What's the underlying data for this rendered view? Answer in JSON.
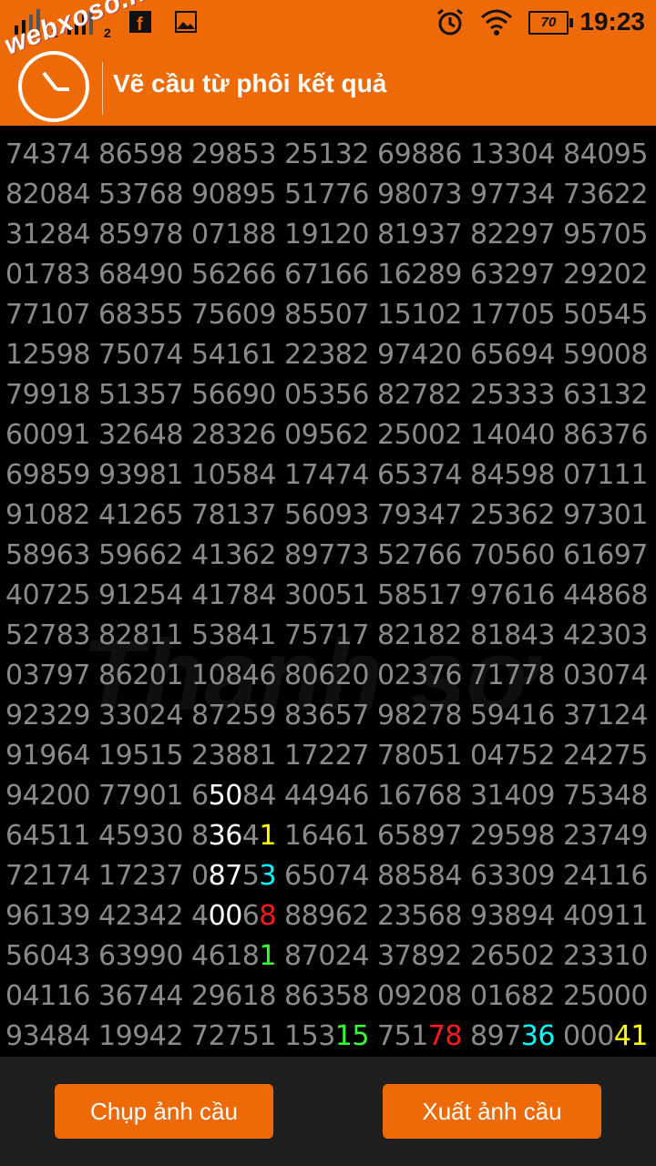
{
  "statusbar": {
    "sim1": "1",
    "sim2": "2",
    "battery": "70",
    "time": "19:23"
  },
  "appbar": {
    "logo": "webxoso.net",
    "title": "Vẽ cầu từ phôi kết quả"
  },
  "watermark": "Thanh sơ",
  "colors": {
    "accent": "#ee6a06",
    "digit_default": "#8a8a8a",
    "white": "#ffffff",
    "yellow": "#ffff00",
    "cyan": "#00ffff",
    "red": "#ff1a1a",
    "green": "#33ff33"
  },
  "rows": [
    [
      "74374",
      "86598",
      "29853",
      "25132",
      "69886",
      "13304",
      "84095"
    ],
    [
      "82084",
      "53768",
      "90895",
      "51776",
      "98073",
      "97734",
      "73622"
    ],
    [
      "31284",
      "85978",
      "07188",
      "19120",
      "81937",
      "82297",
      "95705"
    ],
    [
      "01783",
      "68490",
      "56266",
      "67166",
      "16289",
      "63297",
      "29202"
    ],
    [
      "77107",
      "68355",
      "75609",
      "85507",
      "15102",
      "17705",
      "50545"
    ],
    [
      "12598",
      "75074",
      "54161",
      "22382",
      "97420",
      "65694",
      "59008"
    ],
    [
      "79918",
      "51357",
      "56690",
      "05356",
      "82782",
      "25333",
      "63132"
    ],
    [
      "60091",
      "32648",
      "28326",
      "09562",
      "25002",
      "14040",
      "86376"
    ],
    [
      "69859",
      "93981",
      "10584",
      "17474",
      "65374",
      "84598",
      "07111"
    ],
    [
      "91082",
      "41265",
      "78137",
      "56093",
      "79347",
      "25362",
      "97301"
    ],
    [
      "58963",
      "59662",
      "41362",
      "89773",
      "52766",
      "70560",
      "61697"
    ],
    [
      "40725",
      "91254",
      "41784",
      "30051",
      "58517",
      "97616",
      "44868"
    ],
    [
      "52783",
      "82811",
      "53841",
      "75717",
      "82182",
      "81843",
      "42303"
    ],
    [
      "03797",
      "86201",
      "10846",
      "80620",
      "02376",
      "71778",
      "03074"
    ],
    [
      "92329",
      "33024",
      "87259",
      "83657",
      "98278",
      "59416",
      "37124"
    ],
    [
      "91964",
      "19515",
      "23881",
      "17227",
      "78051",
      "04752",
      "24275"
    ],
    [
      "94200",
      "77901",
      "65084",
      "44946",
      "16768",
      "31409",
      "75348"
    ],
    [
      "64511",
      "45930",
      "83641",
      "16461",
      "65897",
      "29598",
      "23749"
    ],
    [
      "72174",
      "17237",
      "08753",
      "65074",
      "88584",
      "63309",
      "24116"
    ],
    [
      "96139",
      "42342",
      "40068",
      "88962",
      "23568",
      "93894",
      "40911"
    ],
    [
      "56043",
      "63990",
      "46181",
      "87024",
      "37892",
      "26502",
      "23310"
    ],
    [
      "04116",
      "36744",
      "29618",
      "86358",
      "09208",
      "01682",
      "25000"
    ],
    [
      "93484",
      "19942",
      "72751",
      "15315",
      "75178",
      "89736",
      "00041"
    ]
  ],
  "highlights": [
    {
      "row": 16,
      "col": 2,
      "digits": [
        1,
        2
      ],
      "color": "white"
    },
    {
      "row": 17,
      "col": 2,
      "digits": [
        1,
        2
      ],
      "color": "white"
    },
    {
      "row": 17,
      "col": 2,
      "digits": [
        4
      ],
      "color": "yellow"
    },
    {
      "row": 18,
      "col": 2,
      "digits": [
        1,
        2
      ],
      "color": "white"
    },
    {
      "row": 18,
      "col": 2,
      "digits": [
        4
      ],
      "color": "cyan"
    },
    {
      "row": 19,
      "col": 2,
      "digits": [
        1,
        2
      ],
      "color": "white"
    },
    {
      "row": 19,
      "col": 2,
      "digits": [
        4
      ],
      "color": "red"
    },
    {
      "row": 20,
      "col": 2,
      "digits": [
        4
      ],
      "color": "green"
    },
    {
      "row": 22,
      "col": 3,
      "digits": [
        3,
        4
      ],
      "color": "green"
    },
    {
      "row": 22,
      "col": 4,
      "digits": [
        3,
        4
      ],
      "color": "red"
    },
    {
      "row": 22,
      "col": 5,
      "digits": [
        3,
        4
      ],
      "color": "cyan"
    },
    {
      "row": 22,
      "col": 6,
      "digits": [
        3,
        4
      ],
      "color": "yellow"
    }
  ],
  "buttons": {
    "capture": "Chụp ảnh cầu",
    "export": "Xuất ảnh cầu"
  }
}
